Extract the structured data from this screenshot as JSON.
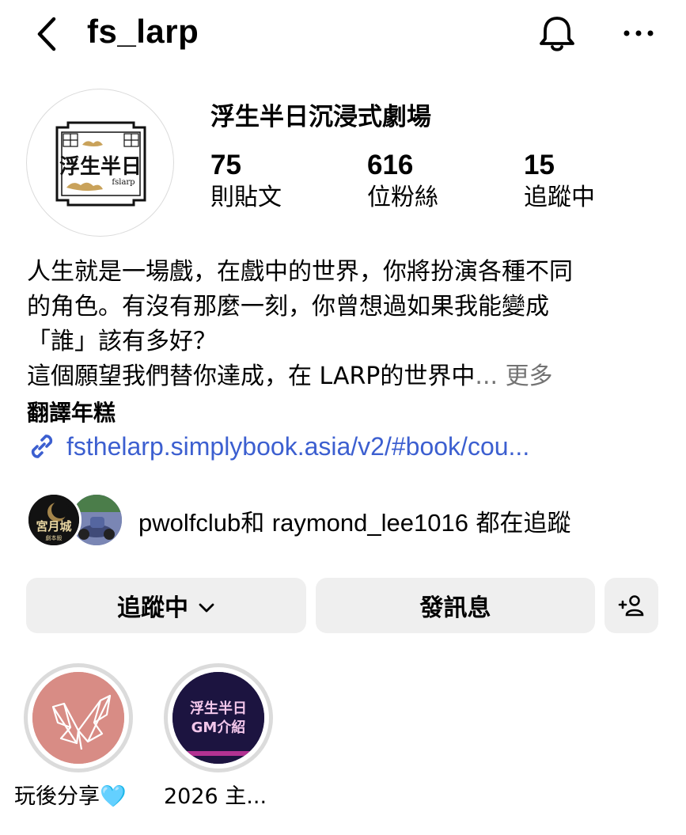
{
  "header": {
    "back_icon": "chevron-left-icon",
    "username": "fs_larp",
    "bell_icon": "bell-icon",
    "more_icon": "more-horizontal-icon"
  },
  "profile": {
    "avatar_logo_text": "浮生半日",
    "avatar_logo_sub": "fslarp",
    "display_name": "浮生半日沉浸式劇場",
    "stats": {
      "posts_count": "75",
      "posts_label": "則貼文",
      "followers_count": "616",
      "followers_label": "位粉絲",
      "following_count": "15",
      "following_label": "追蹤中"
    }
  },
  "bio": {
    "line1": "人生就是一場戲，在戲中的世界，你將扮演各種不同",
    "line2": "的角色。有沒有那麼一刻，你曾想過如果我能變成",
    "line3": "「誰」該有多好？",
    "line4": "這個願望我們替你達成，在 LARP的世界中",
    "ellipsis": "... ",
    "more_label": "更多",
    "translate_label": "翻譯年糕",
    "link_icon": "link-icon",
    "link_text": "fsthelarp.simplybook.asia/v2/#book/cou..."
  },
  "followed_by": {
    "avatar1_text": "宮月城",
    "avatar1_sub": "劇本殺",
    "prefix_account": "pwolfclub",
    "joiner": "和",
    "second_account": "raymond_lee1016",
    "suffix": "都在追蹤"
  },
  "actions": {
    "following_label": "追蹤中",
    "following_chevron_icon": "chevron-down-icon",
    "message_label": "發訊息",
    "add_user_icon": "add-user-icon"
  },
  "highlights": [
    {
      "label": "玩後分享",
      "emoji": "🩵",
      "icon": "butterfly-icon",
      "color": "#d88c85"
    },
    {
      "label": "2026 主...",
      "cover_line1": "浮生半日",
      "cover_line2": "GM介紹",
      "color": "#1c1440"
    }
  ]
}
